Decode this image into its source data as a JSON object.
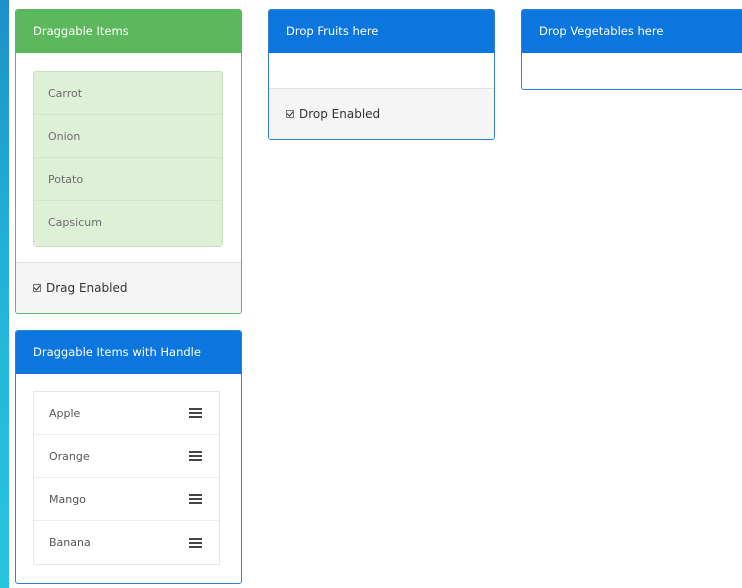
{
  "draggable_panel": {
    "title": "Draggable Items",
    "items": [
      "Carrot",
      "Onion",
      "Potato",
      "Capsicum"
    ],
    "footer_label": "Drag Enabled",
    "drag_enabled": true
  },
  "handle_panel": {
    "title": "Draggable Items with Handle",
    "items": [
      "Apple",
      "Orange",
      "Mango",
      "Banana"
    ]
  },
  "fruits_panel": {
    "title": "Drop Fruits here",
    "footer_label": "Drop Enabled",
    "drop_enabled": true
  },
  "vegetables_panel": {
    "title": "Drop Vegetables here"
  },
  "colors": {
    "success": "#5cb85c",
    "primary": "#0b76dd",
    "list_green": "#dff0d8"
  },
  "icons": {
    "checkbox": "check-icon",
    "drag_handle": "drag-handle-icon"
  }
}
